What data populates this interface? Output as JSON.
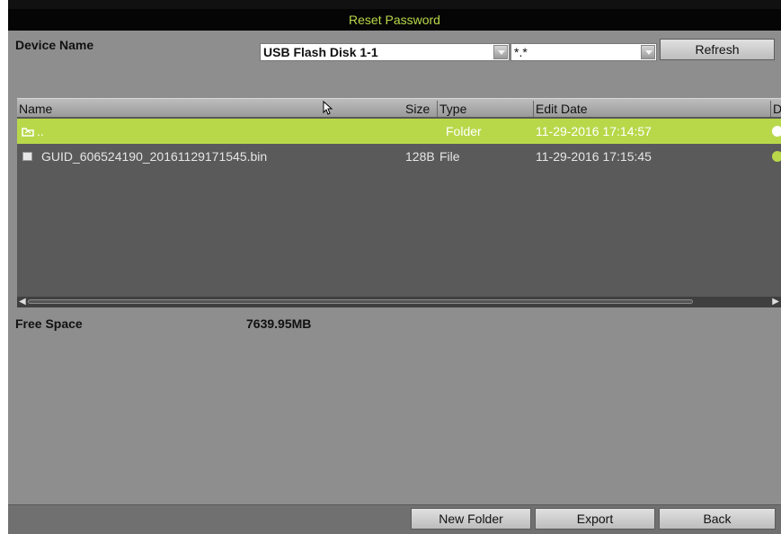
{
  "window": {
    "title": "Reset Password"
  },
  "device": {
    "label": "Device Name",
    "selected": "USB Flash Disk 1-1",
    "filter": "*.*",
    "refresh_label": "Refresh"
  },
  "columns": {
    "name": "Name",
    "size": "Size",
    "type": "Type",
    "edit_date": "Edit Date",
    "delete": "D"
  },
  "rows": [
    {
      "icon": "folder-up-icon",
      "name": "..",
      "size": "",
      "type": "Folder",
      "date": "11-29-2016 17:14:57",
      "selected": true
    },
    {
      "icon": "file-icon",
      "name": "GUID_606524190_20161129171545.bin",
      "size": "128B",
      "type": "File",
      "date": "11-29-2016 17:15:45",
      "selected": false
    }
  ],
  "free_space": {
    "label": "Free Space",
    "value": "7639.95MB"
  },
  "footer": {
    "new_folder": "New Folder",
    "export": "Export",
    "back": "Back"
  },
  "colors": {
    "accent": "#b8d84a",
    "panel": "#8e8e8e",
    "list_bg": "#5a5a5a",
    "title_bg": "#050505"
  }
}
